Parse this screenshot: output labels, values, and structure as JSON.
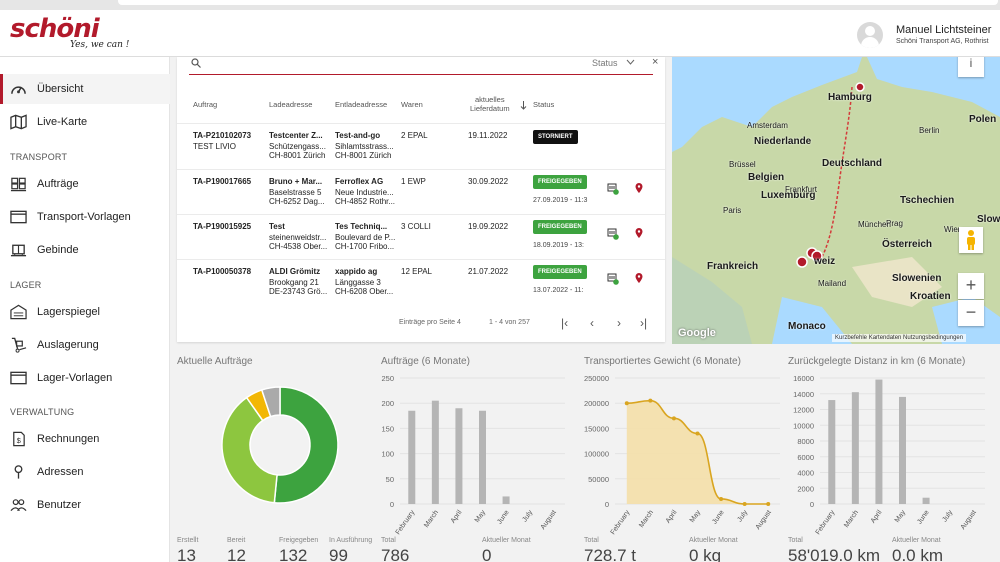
{
  "brand": {
    "name": "schöni",
    "tagline": "Yes, we can !"
  },
  "user": {
    "name": "Manuel Lichtsteiner",
    "company": "Schöni Transport AG, Rothrist"
  },
  "sidebar": {
    "items": [
      {
        "label": "Übersicht",
        "icon": "speedometer-icon"
      },
      {
        "label": "Live-Karte",
        "icon": "map-icon"
      }
    ],
    "sections": [
      {
        "title": "TRANSPORT",
        "items": [
          {
            "label": "Aufträge",
            "icon": "pallet-stack-icon"
          },
          {
            "label": "Transport-Vorlagen",
            "icon": "window-template-icon"
          },
          {
            "label": "Gebinde",
            "icon": "container-icon"
          }
        ]
      },
      {
        "title": "LAGER",
        "items": [
          {
            "label": "Lagerspiegel",
            "icon": "warehouse-icon"
          },
          {
            "label": "Auslagerung",
            "icon": "hand-truck-icon"
          },
          {
            "label": "Lager-Vorlagen",
            "icon": "window-template-icon"
          }
        ]
      },
      {
        "title": "VERWALTUNG",
        "items": [
          {
            "label": "Rechnungen",
            "icon": "invoice-icon"
          },
          {
            "label": "Adressen",
            "icon": "location-pin-icon"
          },
          {
            "label": "Benutzer",
            "icon": "users-icon"
          }
        ]
      }
    ]
  },
  "orders": {
    "search_value": "",
    "status_placeholder": "Status",
    "clear": "×",
    "headers": {
      "auftrag": "Auftrag",
      "lade": "Ladeadresse",
      "entlade": "Entladeadresse",
      "waren": "Waren",
      "datum1": "aktuelles",
      "datum2": "Lieferdatum",
      "status": "Status"
    },
    "rows": [
      {
        "id": "TA-P210102073",
        "ref": "TEST LIVIO",
        "lade": [
          "Testcenter Z...",
          "Schützengass...",
          "CH-8001 Zürich"
        ],
        "entlade": [
          "Test-and-go",
          "Sihlamtsstrass...",
          "CH-8001 Zürich"
        ],
        "waren": "2 EPAL",
        "datum": "19.11.2022",
        "status": "STORNIERT",
        "status_date": ""
      },
      {
        "id": "TA-P190017665",
        "ref": "",
        "lade": [
          "Bruno + Mar...",
          "Baselstrasse 5",
          "CH-6252 Dag..."
        ],
        "entlade": [
          "Ferroflex AG",
          "Neue Industrie...",
          "CH-4852 Rothr..."
        ],
        "waren": "1 EWP",
        "datum": "30.09.2022",
        "status": "FREIGEGEBEN",
        "status_date": "27.09.2019 - 11:3"
      },
      {
        "id": "TA-P190015925",
        "ref": "",
        "lade": [
          "Test",
          "steinenweidstr...",
          "CH-4538 Ober..."
        ],
        "entlade": [
          "Tes Techniq...",
          "Boulevard de P...",
          "CH-1700 Fribo..."
        ],
        "waren": "3 COLLI",
        "datum": "19.09.2022",
        "status": "FREIGEGEBEN",
        "status_date": "18.09.2019 - 13:"
      },
      {
        "id": "TA-P100050378",
        "ref": "",
        "lade": [
          "ALDI Grömitz",
          "Brookgang 21",
          "DE-23743 Grö..."
        ],
        "entlade": [
          "xappido ag",
          "Länggasse 3",
          "CH-6208 Ober..."
        ],
        "waren": "12 EPAL",
        "datum": "21.07.2022",
        "status": "FREIGEGEBEN",
        "status_date": "13.07.2022 - 11:"
      }
    ],
    "pager": {
      "per_page_label": "Einträge pro Seite 4",
      "range": "1 - 4 von 257"
    }
  },
  "map": {
    "labels": [
      "Hamburg",
      "Amsterdam",
      "Niederlande",
      "Deutschland",
      "Polen",
      "Brüssel",
      "Belgien",
      "Luxemburg",
      "Tschechien",
      "Paris",
      "Slowa",
      "Frankreich",
      "Österreich",
      "Slowenien",
      "Kroatien",
      "Mailand",
      "Monaco",
      "Berlin",
      "Prag",
      "München",
      "Wien",
      "Frankfurt",
      "weiz"
    ],
    "footer": "Kurzbefehle    Kartendaten    Nutzungsbedingungen",
    "google": "Google",
    "zoom_in": "+",
    "zoom_out": "−",
    "info": "i"
  },
  "panels": {
    "p1": {
      "title": "Aktuelle Aufträge"
    },
    "p2": {
      "title": "Aufträge (6 Monate)"
    },
    "p3": {
      "title": "Transportiertes Gewicht (6 Monate)"
    },
    "p4": {
      "title": "Zurückgelegte Distanz in km (6 Monate)"
    }
  },
  "stats": [
    {
      "label": "Erstellt",
      "value": "13"
    },
    {
      "label": "Bereit",
      "value": "12"
    },
    {
      "label": "Freigegeben",
      "value": "132"
    },
    {
      "label": "In Ausführung",
      "value": "99"
    },
    {
      "label": "Total",
      "value": "786"
    },
    {
      "label": "Aktueller Monat",
      "value": "0"
    },
    {
      "label": "Total",
      "value": "728.7 t"
    },
    {
      "label": "Aktueller Monat",
      "value": "0 kg"
    },
    {
      "label": "Total",
      "value": "58'019.0 km"
    },
    {
      "label": "Aktueller Monat",
      "value": "0.0 km"
    }
  ],
  "chart_data": [
    {
      "type": "pie",
      "title": "Aktuelle Aufträge",
      "labels": [
        "Freigegeben",
        "In Ausführung",
        "Bereit",
        "Erstellt"
      ],
      "values": [
        132,
        99,
        12,
        13
      ],
      "colors": [
        "#3da33f",
        "#8dc63f",
        "#f2b705",
        "#aaaaaa"
      ]
    },
    {
      "type": "bar",
      "title": "Aufträge (6 Monate)",
      "categories": [
        "February",
        "March",
        "April",
        "May",
        "June",
        "July",
        "August"
      ],
      "values": [
        185,
        205,
        190,
        185,
        15,
        0,
        0
      ],
      "ylim": [
        0,
        250
      ],
      "yticks": [
        0,
        50,
        100,
        150,
        200,
        250
      ]
    },
    {
      "type": "area",
      "title": "Transportiertes Gewicht (6 Monate)",
      "categories": [
        "February",
        "March",
        "April",
        "May",
        "June",
        "July",
        "August"
      ],
      "values": [
        200000,
        205000,
        170000,
        140000,
        10000,
        0,
        0
      ],
      "ylim": [
        0,
        250000
      ],
      "yticks": [
        0,
        50000,
        100000,
        150000,
        200000,
        250000
      ]
    },
    {
      "type": "bar",
      "title": "Zurückgelegte Distanz in km (6 Monate)",
      "categories": [
        "February",
        "March",
        "April",
        "May",
        "June",
        "July",
        "August"
      ],
      "values": [
        13200,
        14200,
        15800,
        13600,
        800,
        0,
        0
      ],
      "ylim": [
        0,
        16000
      ],
      "yticks": [
        0,
        2000,
        4000,
        6000,
        8000,
        10000,
        12000,
        14000,
        16000
      ]
    }
  ]
}
